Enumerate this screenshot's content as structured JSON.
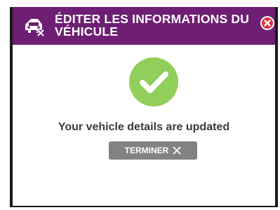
{
  "dialog": {
    "title": "ÉDITER LES INFORMATIONS DU VÉHICULE",
    "header_icon": "car-edit-icon",
    "close_icon": "close-circle-icon",
    "success_icon": "check-circle-icon",
    "message": "Your vehicle details are updated",
    "finish_button": {
      "label": "TERMINER",
      "icon": "close-icon"
    }
  },
  "colors": {
    "header_bg": "#6e1f74",
    "success_green": "#8fcf5a",
    "close_red": "#e2313b",
    "button_gray": "#828282"
  }
}
